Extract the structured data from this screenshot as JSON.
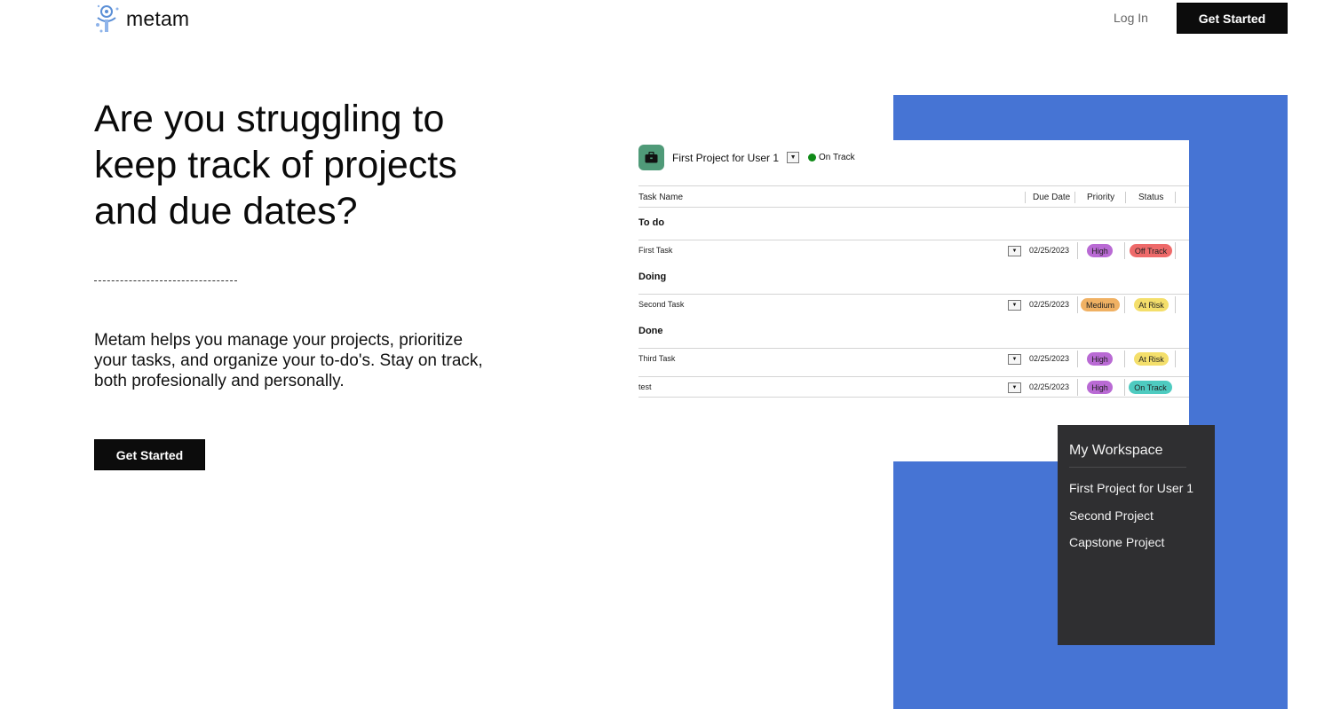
{
  "header": {
    "brand": "metam",
    "login": "Log In",
    "cta": "Get Started"
  },
  "hero": {
    "title": "Are you struggling to keep track of projects and due dates?",
    "description": "Metam helps you manage your projects, prioritize your tasks, and organize your to-do's. Stay on track, both profesionally and personally.",
    "cta": "Get Started"
  },
  "project_card": {
    "project_name": "First Project for User 1",
    "status": "On Track",
    "status_color": "#0f8a17",
    "columns": [
      "Task Name",
      "Due Date",
      "Priority",
      "Status"
    ],
    "groups": [
      {
        "name": "To do",
        "tasks": [
          {
            "name": "First Task",
            "due": "02/25/2023",
            "priority": "High",
            "priority_color": "#b96ad4",
            "status": "Off Track",
            "status_color": "#ee6a6a"
          }
        ]
      },
      {
        "name": "Doing",
        "tasks": [
          {
            "name": "Second Task",
            "due": "02/25/2023",
            "priority": "Medium",
            "priority_color": "#f0b163",
            "status": "At Risk",
            "status_color": "#f4df6b"
          }
        ]
      },
      {
        "name": "Done",
        "tasks": [
          {
            "name": "Third Task",
            "due": "02/25/2023",
            "priority": "High",
            "priority_color": "#b96ad4",
            "status": "At Risk",
            "status_color": "#f4df6b"
          },
          {
            "name": "test",
            "due": "02/25/2023",
            "priority": "High",
            "priority_color": "#b96ad4",
            "status": "On Track",
            "status_color": "#4ecbc0"
          }
        ]
      }
    ]
  },
  "workspace": {
    "title": "My Workspace",
    "projects": [
      "First Project for User 1",
      "Second Project",
      "Capstone Project"
    ]
  },
  "colors": {
    "accent_blue": "#4674d4",
    "button_black": "#0c0c0c",
    "panel_dark": "#2f2f31"
  }
}
